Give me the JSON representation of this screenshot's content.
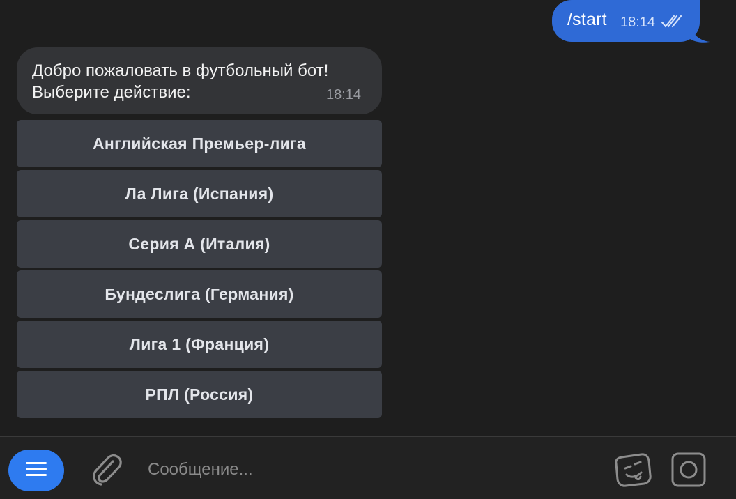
{
  "outgoing": {
    "text": "/start",
    "time": "18:14"
  },
  "incoming": {
    "line1": "Добро пожаловать в футбольный бот!",
    "line2": "Выберите действие:",
    "time": "18:14"
  },
  "keyboard": [
    "Английская Премьер-лига",
    "Ла Лига (Испания)",
    "Серия А (Италия)",
    "Бундеслига (Германия)",
    "Лига 1 (Франция)",
    "РПЛ (Россия)"
  ],
  "input": {
    "placeholder": "Сообщение..."
  },
  "colors": {
    "outgoing_bubble": "#2f6ad6",
    "incoming_bubble": "#333437",
    "keyboard_button": "#3b3e45",
    "menu_button": "#2e7bf0",
    "background": "#1e1e1e"
  },
  "icons": [
    "menu-icon",
    "paperclip-icon",
    "sticker-icon",
    "camera-icon",
    "double-check-icon"
  ]
}
